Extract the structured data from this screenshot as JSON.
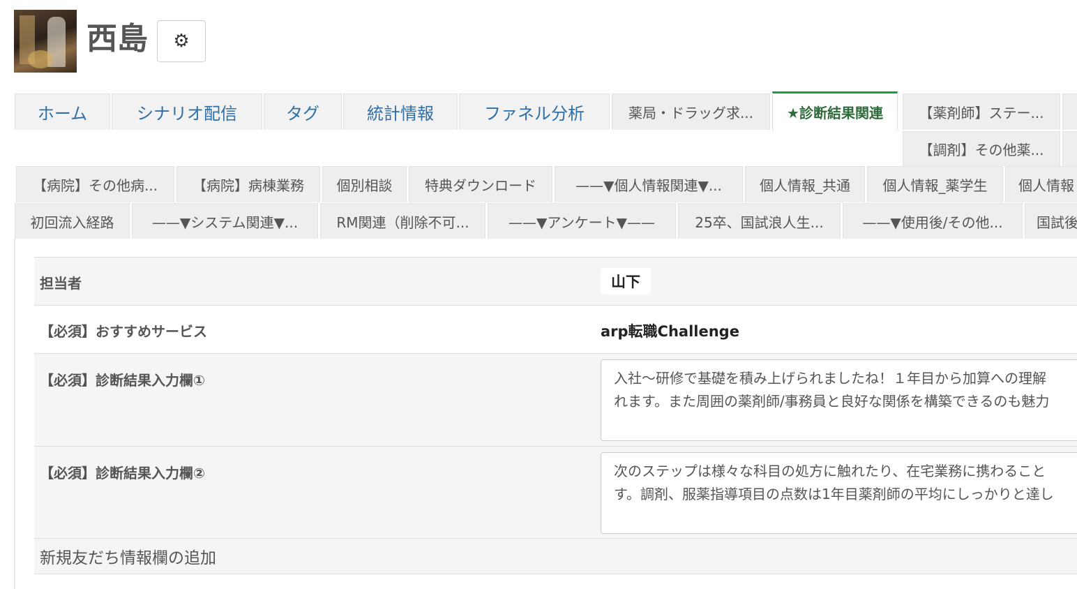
{
  "profile": {
    "name": "西島"
  },
  "tabs": {
    "main": [
      "ホーム",
      "シナリオ配信",
      "タグ",
      "統計情報",
      "ファネル分析"
    ],
    "row1_extra": [
      "薬局・ドラッグ求...",
      "★診断結果関連",
      "【薬剤師】ステー..."
    ],
    "row2": [
      "【調剤】その他薬..."
    ],
    "row3": [
      "【病院】その他病...",
      "【病院】病棟業務",
      "個別相談",
      "特典ダウンロード",
      "——▼個人情報関連▼...",
      "個人情報_共通",
      "個人情報_薬学生",
      "個人情報"
    ],
    "row4": [
      "初回流入経路",
      "——▼システム関連▼...",
      "RM関連（削除不可...",
      "——▼アンケート▼——",
      "25卒、国試浪人生...",
      "——▼使用後/その他...",
      "国試後"
    ]
  },
  "fields": {
    "assignee_label": "担当者",
    "assignee_value": "山下",
    "service_label": "【必須】おすすめサービス",
    "service_value": "arp転職Challenge",
    "result1_label": "【必須】診断結果入力欄①",
    "result1_line1": "入社〜研修で基礎を積み上げられましたね！１年目から加算への理解",
    "result1_line2": "れます。また周囲の薬剤師/事務員と良好な関係を構築できるのも魅力",
    "result2_label": "【必須】診断結果入力欄②",
    "result2_line1": "次のステップは様々な科目の処方に触れたり、在宅業務に携わること",
    "result2_line2": "す。調剤、服薬指導項目の点数は1年目薬剤師の平均にしっかりと達し"
  },
  "add_field_label": "新規友だち情報欄の追加",
  "colors": {
    "active_tab_accent": "#1a9c3f",
    "main_tab_text": "#2f6fa7"
  },
  "icons": {
    "settings": "gear-icon"
  }
}
